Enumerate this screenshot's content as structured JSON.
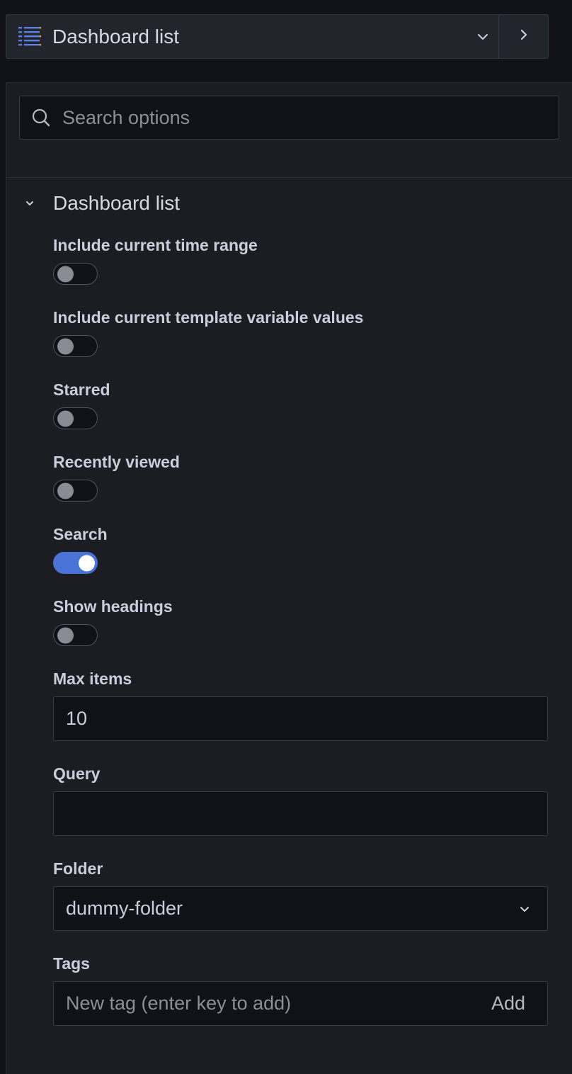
{
  "colors": {
    "accent": "#4a73d8",
    "background": "#111217",
    "panel": "#1c1d22"
  },
  "viz_picker": {
    "title": "Dashboard list",
    "icon": "list-icon"
  },
  "search": {
    "placeholder": "Search options"
  },
  "section": {
    "title": "Dashboard list",
    "expanded": true
  },
  "toggles": [
    {
      "label": "Include current time range",
      "on": false
    },
    {
      "label": "Include current template variable values",
      "on": false
    },
    {
      "label": "Starred",
      "on": false
    },
    {
      "label": "Recently viewed",
      "on": false
    },
    {
      "label": "Search",
      "on": true
    },
    {
      "label": "Show headings",
      "on": false
    }
  ],
  "max_items": {
    "label": "Max items",
    "value": "10"
  },
  "query": {
    "label": "Query",
    "value": ""
  },
  "folder": {
    "label": "Folder",
    "value": "dummy-folder"
  },
  "tags": {
    "label": "Tags",
    "placeholder": "New tag (enter key to add)",
    "add_label": "Add"
  }
}
